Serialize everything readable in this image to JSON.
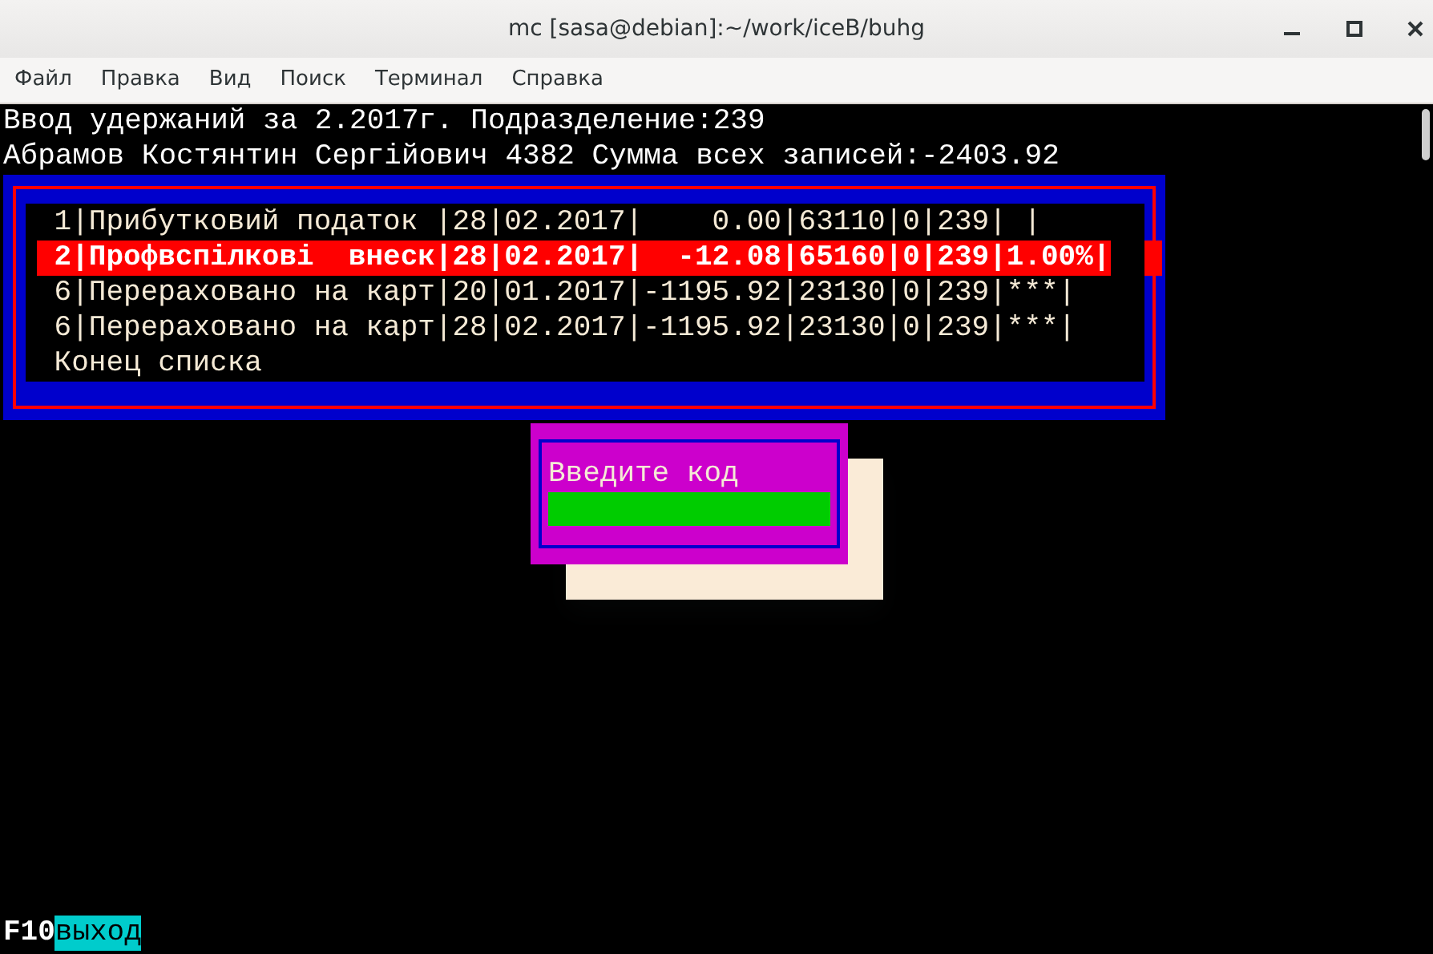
{
  "window": {
    "title": "mc [sasa@debian]:~/work/iceB/buhg"
  },
  "menu": [
    "Файл",
    "Правка",
    "Вид",
    "Поиск",
    "Терминал",
    "Справка"
  ],
  "terminal": {
    "header_lines": [
      "Ввод удержаний за 2.2017г. Подразделение:239",
      "Абрамов Костянтин Сергійович 4382 Сумма всех записей:-2403.92"
    ],
    "list": {
      "rows": [
        {
          "text": "1|Прибутковий податок |28|02.2017|    0.00|63110|0|239| |",
          "selected": false
        },
        {
          "text": "2|Профвспілкові  внеск|28|02.2017|  -12.08|65160|0|239|1.00%|",
          "selected": true
        },
        {
          "text": "6|Перераховано на карт|20|01.2017|-1195.92|23130|0|239|***|",
          "selected": false
        },
        {
          "text": "6|Перераховано на карт|28|02.2017|-1195.92|23130|0|239|***|",
          "selected": false
        }
      ],
      "footer": "Конец списка"
    },
    "dialog": {
      "prompt": "Введите код"
    },
    "key_bar": [
      {
        "key": "F10",
        "label": "выход"
      }
    ]
  }
}
